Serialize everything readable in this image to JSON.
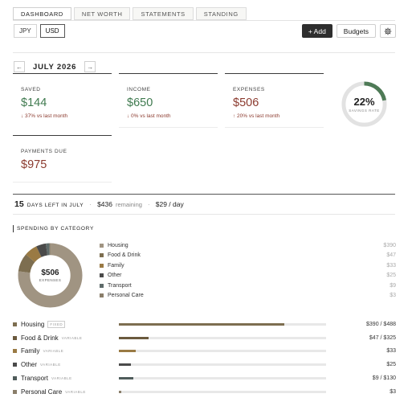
{
  "tabs": [
    {
      "label": "Dashboard",
      "active": true
    },
    {
      "label": "Net Worth",
      "active": false
    },
    {
      "label": "Statements",
      "active": false
    },
    {
      "label": "Standing",
      "active": false
    }
  ],
  "currencies": [
    {
      "label": "JPY",
      "active": false
    },
    {
      "label": "USD",
      "active": true
    }
  ],
  "toolbar": {
    "add_label": "+ Add",
    "budgets_label": "Budgets",
    "settings_icon": "gear-icon"
  },
  "month_nav": {
    "prev": "←",
    "label": "JULY 2026",
    "next": "→"
  },
  "stats": {
    "saved": {
      "label": "Saved",
      "value": "$144",
      "delta": "↓ 37% vs last month"
    },
    "income": {
      "label": "Income",
      "value": "$650",
      "delta": "↓ 0% vs last month"
    },
    "expenses": {
      "label": "Expenses",
      "value": "$506",
      "delta": "↑ 20% vs last month"
    },
    "payments_due": {
      "label": "Payments Due",
      "value": "$975"
    }
  },
  "savings_rate": {
    "value": "22%",
    "label": "Savings Rate",
    "fraction": 0.22,
    "color": "#4e7a56"
  },
  "days_left": {
    "num": "15",
    "text": "days left in July",
    "remaining_amt": "$436",
    "remaining_label": "remaining",
    "per_day": "$29 / day"
  },
  "spending": {
    "title": "Spending by Category",
    "total_value": "$506",
    "total_label": "Expenses",
    "categories": [
      {
        "name": "Housing",
        "amount": "$390",
        "value": 390,
        "color": "#a09482"
      },
      {
        "name": "Food & Drink",
        "amount": "$47",
        "value": 47,
        "color": "#7d6e50"
      },
      {
        "name": "Family",
        "amount": "$33",
        "value": 33,
        "color": "#9a7a44"
      },
      {
        "name": "Other",
        "amount": "$25",
        "value": 25,
        "color": "#4a4a4a"
      },
      {
        "name": "Transport",
        "amount": "$9",
        "value": 9,
        "color": "#5e6b6a"
      },
      {
        "name": "Personal Care",
        "amount": "$3",
        "value": 3,
        "color": "#8a7e6a"
      }
    ]
  },
  "budget_rows": [
    {
      "name": "Housing",
      "tag": "Fixed",
      "boxed": true,
      "amount": "$390 / $488",
      "fill": 0.8,
      "color": "#7d6e50"
    },
    {
      "name": "Food & Drink",
      "tag": "Variable",
      "boxed": false,
      "amount": "$47 / $325",
      "fill": 0.145,
      "color": "#6b5a3e"
    },
    {
      "name": "Family",
      "tag": "Variable",
      "boxed": false,
      "amount": "$33",
      "fill": 0.08,
      "color": "#9a7a44"
    },
    {
      "name": "Other",
      "tag": "Variable",
      "boxed": false,
      "amount": "$25",
      "fill": 0.06,
      "color": "#4a4a4a"
    },
    {
      "name": "Transport",
      "tag": "Variable",
      "boxed": false,
      "amount": "$9 / $130",
      "fill": 0.07,
      "color": "#4f5c5b"
    },
    {
      "name": "Personal Care",
      "tag": "Variable",
      "boxed": false,
      "amount": "$3",
      "fill": 0.01,
      "color": "#8a7e6a"
    }
  ]
}
